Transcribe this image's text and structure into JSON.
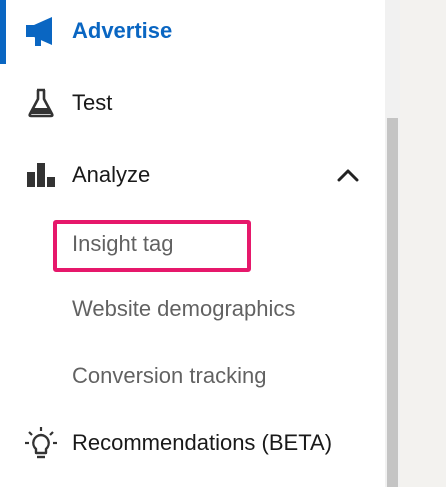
{
  "nav": {
    "advertise": {
      "label": "Advertise",
      "icon": "megaphone-icon"
    },
    "test": {
      "label": "Test",
      "icon": "flask-icon"
    },
    "analyze": {
      "label": "Analyze",
      "icon": "bar-chart-icon",
      "expanded": true
    }
  },
  "analyze_subitems": [
    {
      "label": "Insight tag",
      "highlighted": true
    },
    {
      "label": "Website demographics"
    },
    {
      "label": "Conversion tracking"
    }
  ],
  "recommendations": {
    "label": "Recommendations (BETA)",
    "icon": "lightbulb-icon"
  },
  "colors": {
    "accent": "#0a66c2",
    "highlight": "#e6186b",
    "text_primary": "#191919",
    "text_secondary": "#5e5e5e"
  }
}
